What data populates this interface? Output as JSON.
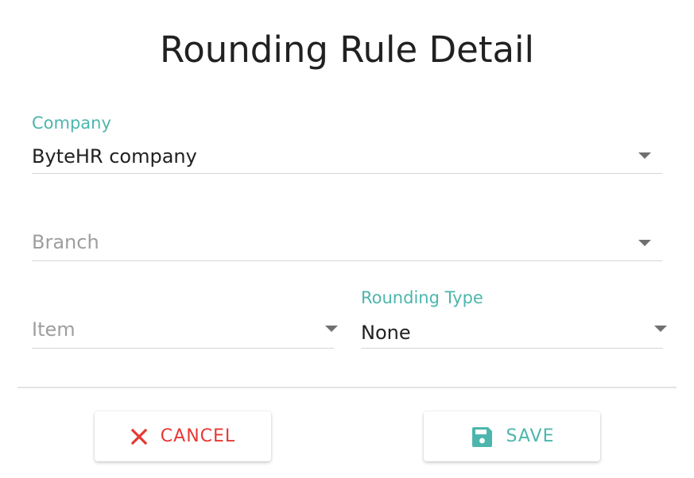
{
  "dialog": {
    "title": "Rounding Rule Detail"
  },
  "form": {
    "company": {
      "label": "Company",
      "value": "ByteHR company"
    },
    "branch": {
      "placeholder": "Branch"
    },
    "item": {
      "placeholder": "Item"
    },
    "rounding_type": {
      "label": "Rounding Type",
      "value": "None"
    }
  },
  "actions": {
    "cancel_label": "CANCEL",
    "cancel_icon": "close-icon",
    "save_label": "SAVE",
    "save_icon": "floppy-disk-icon"
  },
  "colors": {
    "accent": "#4db6ac",
    "danger": "#e53935",
    "placeholder": "#9e9e9e",
    "text": "#212121"
  }
}
